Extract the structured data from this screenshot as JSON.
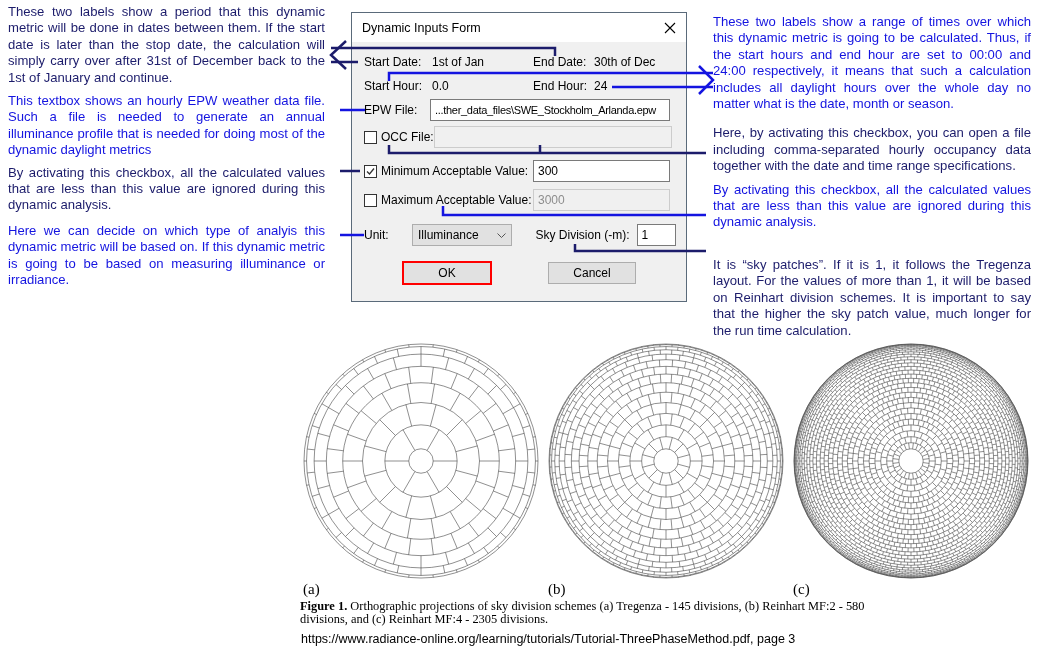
{
  "notes_left": [
    {
      "text": "These two labels show a period that this dynamic metric will be done in dates between them. If the start date is later than the stop date, the calculation will simply carry over after 31st of December back to the 1st of January and continue.",
      "color": "#1c1c6b"
    },
    {
      "text": "This textbox shows an hourly EPW weather data file. Such a file is needed to generate an annual illuminance profile that is needed for doing most of the dynamic daylight metrics",
      "color": "#1414e0"
    },
    {
      "text": "By activating this checkbox, all the calculated values that are less than this value are ignored during this dynamic analysis.",
      "color": "#1c1c6b"
    },
    {
      "text": "Here we can decide on which type of analyis this dynamic metric will be based on. If this dynamic metric is going to be based on measuring illuminance or irradiance.",
      "color": "#1414e0"
    }
  ],
  "dialog": {
    "title": "Dynamic Inputs Form",
    "start_date": {
      "label": "Start Date:",
      "value": "1st of Jan"
    },
    "end_date": {
      "label": "End Date:",
      "value": "30th of Dec"
    },
    "start_hour": {
      "label": "Start Hour:",
      "value": "0.0"
    },
    "end_hour": {
      "label": "End Hour:",
      "value": "24"
    },
    "epw_file": {
      "label": "EPW File:",
      "value": "...ther_data_files\\SWE_Stockholm_Arlanda.epw"
    },
    "occ_file": {
      "label": "OCC File:",
      "checked": false,
      "disabled": true
    },
    "minimum": {
      "label": "Minimum Acceptable Value:",
      "checked": true,
      "value": "300",
      "disabled": false
    },
    "maximum": {
      "label": "Maximum Acceptable Value:",
      "checked": false,
      "value": "3000",
      "disabled": true
    },
    "unit": {
      "label": "Unit:",
      "value": "Illuminance"
    },
    "sky_division": {
      "label": "Sky Division (-m):",
      "value": "1"
    },
    "buttons": [
      {
        "label": "OK",
        "highlighted": true
      },
      {
        "label": "Cancel",
        "highlighted": false
      }
    ]
  },
  "notes_right": [
    {
      "text": "These two labels show a range of times over which this dynamic metric is going to be calculated. Thus, if the start hours and end hour are set to 00:00 and 24:00 respectively, it means that such a calculation includes all daylight hours over the whole day no matter what is the date, month or season.",
      "color": "#1414e0"
    },
    {
      "text": "Here, by activating this checkbox, you can open a file including comma-separated hourly occupancy data together with the date and time range specifications.",
      "color": "#1c1c6b"
    },
    {
      "text": "By activating this checkbox, all the calculated values that are less than this value are ignored during this dynamic analysis.",
      "color": "#1414e0"
    },
    {
      "text": "It is “sky patches”. If it is 1, it follows the Tregenza layout. For the values of more than 1, it will be based on Reinhart division schemes. It is important to say that the higher the sky patch value, much longer for the run time calculation.",
      "color": "#1c1c6b"
    }
  ],
  "figure": {
    "panels": [
      {
        "label": "(a)",
        "kind": "tregenza"
      },
      {
        "label": "(b)",
        "kind": "reinhart2"
      },
      {
        "label": "(c)",
        "kind": "reinhart4"
      }
    ],
    "caption": "**Figure 1.** Orthographic projections of sky division schemes (a) Tregenza - 145 divisions, (b) Reinhart MF:2 - 580 divisions, and (c) Reinhart MF:4 - 2305 divisions.",
    "source": "https://www.radiance-online.org/learning/tutorials/Tutorial-ThreePhaseMethod.pdf, page 3"
  }
}
